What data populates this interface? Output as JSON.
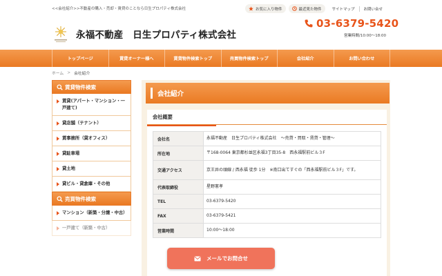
{
  "topbar": {
    "tagline": "<<会社紹介>>不動産の購入・売却・賃貸のことなら日生プロパティ株式会社",
    "favorites_label": "お気に入り物件",
    "recent_label": "最近見た物件",
    "sitemap_label": "サイトマップ",
    "contact_label": "お問い合せ"
  },
  "header": {
    "company_name": "永福不動産　日生プロパティ株式会社",
    "phone": "03-6379-5420",
    "hours": "営業時間/10:00～18:00"
  },
  "nav": {
    "items": [
      {
        "label": "トップページ"
      },
      {
        "label": "賃貸オーナー様へ"
      },
      {
        "label": "賃貸物件検索トップ"
      },
      {
        "label": "売買物件検索トップ"
      },
      {
        "label": "会社紹介"
      },
      {
        "label": "お問い合わせ"
      }
    ]
  },
  "breadcrumb": {
    "home": "ホーム",
    "sep": ">",
    "current": "会社紹介"
  },
  "sidebar": {
    "rental_heading": "賃貸物件検索",
    "rental_items": [
      {
        "label": "賃貸(アパート・マンション・一戸建て)"
      },
      {
        "label": "貸店舗（テナント）"
      },
      {
        "label": "賃事務所（貸オフィス）"
      },
      {
        "label": "貸駐車場"
      },
      {
        "label": "貸土地"
      },
      {
        "label": "貸ビル・貸倉庫・その他"
      }
    ],
    "sale_heading": "売買物件検索",
    "sale_items": [
      {
        "label": "マンション（新築・分譲・中古）"
      },
      {
        "label": "一戸建て（新築・中古）"
      }
    ]
  },
  "main": {
    "title": "会社紹介",
    "section_title": "会社概要",
    "rows": [
      {
        "label": "会社名",
        "value": "永福不動産　日生プロパティ株式会社　～売貸・買取・賃貸・管理～"
      },
      {
        "label": "所在地",
        "value": "〒168-0064 東京都杉並区永福3丁目35-8　西永福駅前ビル３F"
      },
      {
        "label": "交通アクセス",
        "value": "京王井の頭線 / 西永福 徒歩 1分　※南口出てすぐの「西永福駅前ビル３F」です。"
      },
      {
        "label": "代表取締役",
        "value": "星野憲孝"
      },
      {
        "label": "TEL",
        "value": "03-6379-5420"
      },
      {
        "label": "FAX",
        "value": "03-6379-5421"
      },
      {
        "label": "営業時間",
        "value": "10:00～18:00"
      }
    ]
  },
  "cta": {
    "label": "メールでお問合せ"
  },
  "colors": {
    "accent": "#ea7a23",
    "phone": "#e8541a",
    "cta": "#f0735b"
  }
}
